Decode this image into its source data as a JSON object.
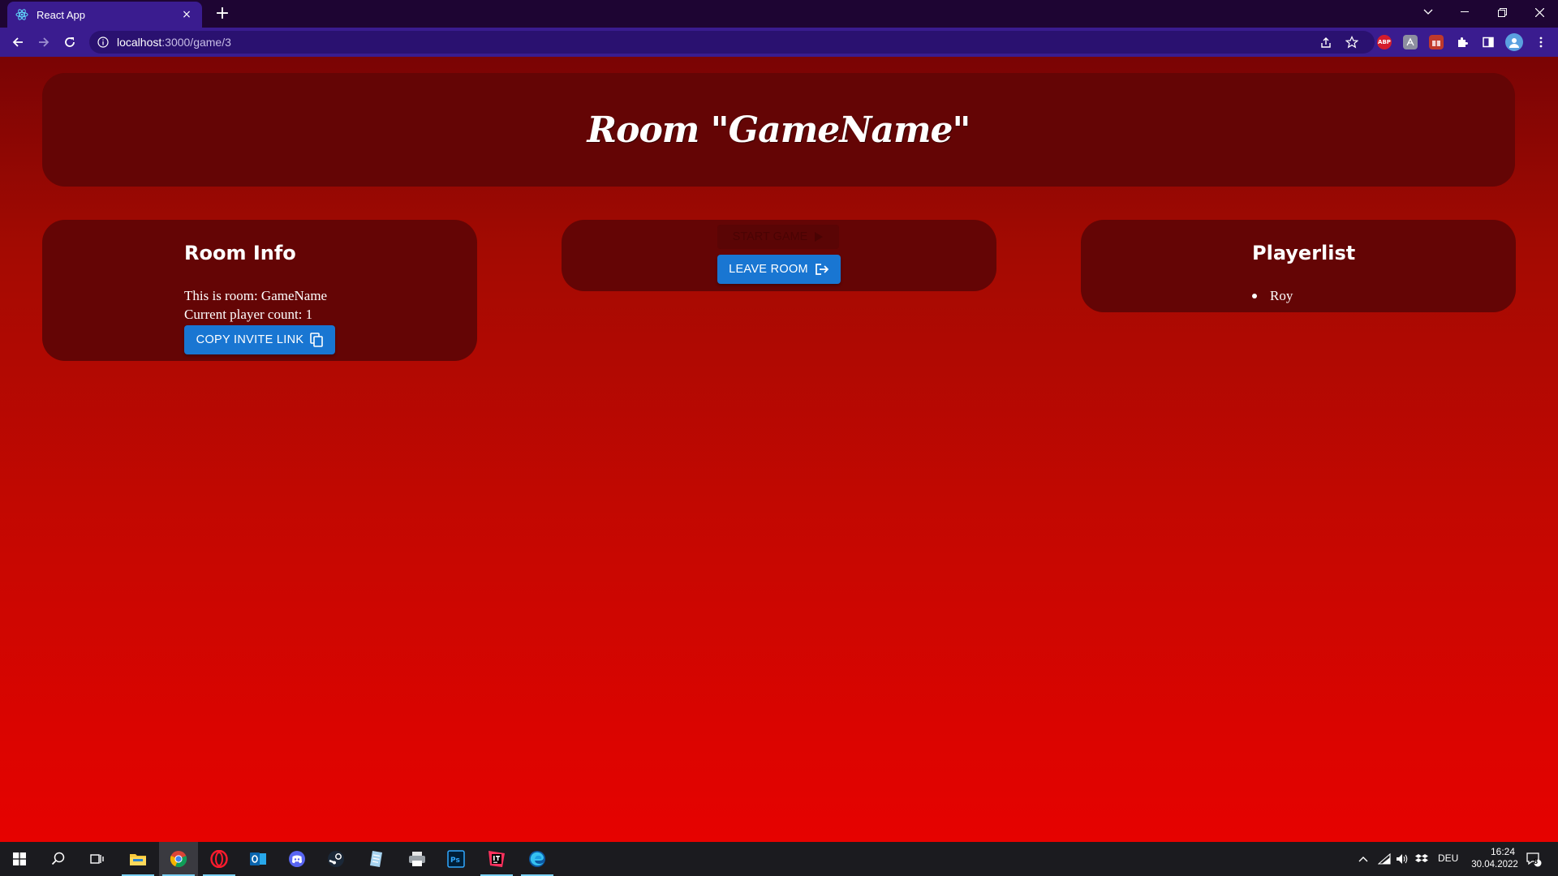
{
  "browser": {
    "tab_title": "React App",
    "tab_close": "×",
    "new_tab": "+",
    "url_host": "localhost",
    "url_path": ":3000/game/3",
    "extensions": [
      "ABP"
    ]
  },
  "page": {
    "title": "Room \"GameName\"",
    "room_info": {
      "heading": "Room Info",
      "room_line": "This is room: GameName",
      "count_line": "Current player count: 1",
      "copy_button": "COPY INVITE LINK"
    },
    "controls": {
      "start_button": "START GAME",
      "leave_button": "LEAVE ROOM"
    },
    "playerlist": {
      "heading": "Playerlist",
      "players": [
        "Roy"
      ]
    }
  },
  "taskbar": {
    "language": "DEU",
    "time": "16:24",
    "date": "30.04.2022",
    "notification_count": "8"
  },
  "colors": {
    "accent_button": "#1976d2",
    "card_bg": "#640505",
    "browser_chrome": "#3a1c8f"
  }
}
